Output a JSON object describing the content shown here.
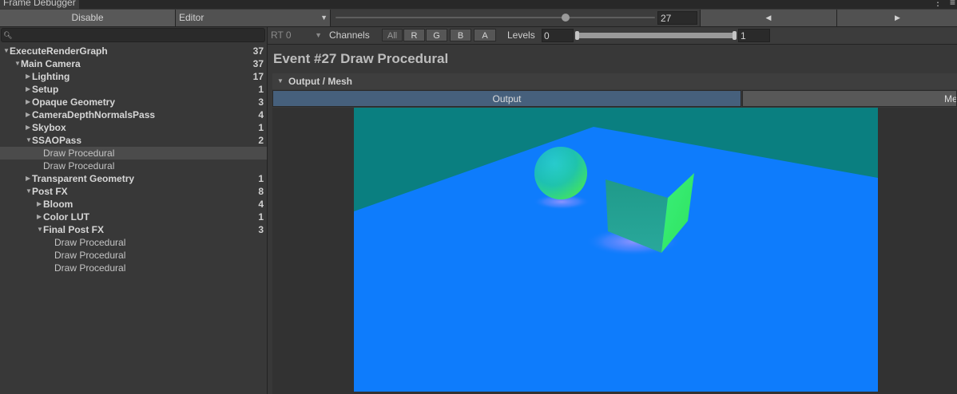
{
  "window": {
    "title": "Frame Debugger",
    "more_icon": "kebab-menu-icon"
  },
  "toolbar": {
    "disable_label": "Disable",
    "target_value": "Editor",
    "event_index": "27",
    "prev_icon": "triangle-left-icon",
    "next_icon": "triangle-right-icon",
    "slider_fraction": 0.72
  },
  "search": {
    "value": "",
    "icon": "search-icon"
  },
  "tree": [
    {
      "label": "ExecuteRenderGraph",
      "count": "37",
      "depth": 0,
      "arrow": "down",
      "bold": true
    },
    {
      "label": "Main Camera",
      "count": "37",
      "depth": 1,
      "arrow": "down",
      "bold": true
    },
    {
      "label": "Lighting",
      "count": "17",
      "depth": 2,
      "arrow": "right",
      "bold": true
    },
    {
      "label": "Setup",
      "count": "1",
      "depth": 2,
      "arrow": "right",
      "bold": true
    },
    {
      "label": "Opaque Geometry",
      "count": "3",
      "depth": 2,
      "arrow": "right",
      "bold": true
    },
    {
      "label": "CameraDepthNormalsPass",
      "count": "4",
      "depth": 2,
      "arrow": "right",
      "bold": true
    },
    {
      "label": "Skybox",
      "count": "1",
      "depth": 2,
      "arrow": "right",
      "bold": true
    },
    {
      "label": "SSAOPass",
      "count": "2",
      "depth": 2,
      "arrow": "down",
      "bold": true
    },
    {
      "label": "Draw Procedural",
      "count": "",
      "depth": 3,
      "arrow": "",
      "bold": false,
      "selected": true
    },
    {
      "label": "Draw Procedural",
      "count": "",
      "depth": 3,
      "arrow": "",
      "bold": false
    },
    {
      "label": "Transparent Geometry",
      "count": "1",
      "depth": 2,
      "arrow": "right",
      "bold": true
    },
    {
      "label": "Post FX",
      "count": "8",
      "depth": 2,
      "arrow": "down",
      "bold": true
    },
    {
      "label": "Bloom",
      "count": "4",
      "depth": 3,
      "arrow": "right",
      "bold": true
    },
    {
      "label": "Color LUT",
      "count": "1",
      "depth": 3,
      "arrow": "right",
      "bold": true
    },
    {
      "label": "Final Post FX",
      "count": "3",
      "depth": 3,
      "arrow": "down",
      "bold": true
    },
    {
      "label": "Draw Procedural",
      "count": "",
      "depth": 4,
      "arrow": "",
      "bold": false
    },
    {
      "label": "Draw Procedural",
      "count": "",
      "depth": 4,
      "arrow": "",
      "bold": false
    },
    {
      "label": "Draw Procedural",
      "count": "",
      "depth": 4,
      "arrow": "",
      "bold": false
    }
  ],
  "render_target": {
    "value": "RT 0"
  },
  "channels": {
    "label": "Channels",
    "buttons": [
      "All",
      "R",
      "G",
      "B",
      "A"
    ]
  },
  "levels": {
    "label": "Levels",
    "min": "0",
    "max": "1"
  },
  "event": {
    "title": "Event #27 Draw Procedural",
    "section_label": "Output / Mesh",
    "tab_output": "Output",
    "tab_mesh": "Me"
  },
  "colors": {
    "background": "#383838",
    "selected_row": "#4b4b4b",
    "active_tab": "#46607c",
    "preview_sky": "#0a7f80",
    "preview_floor": "#0e7cfc"
  }
}
